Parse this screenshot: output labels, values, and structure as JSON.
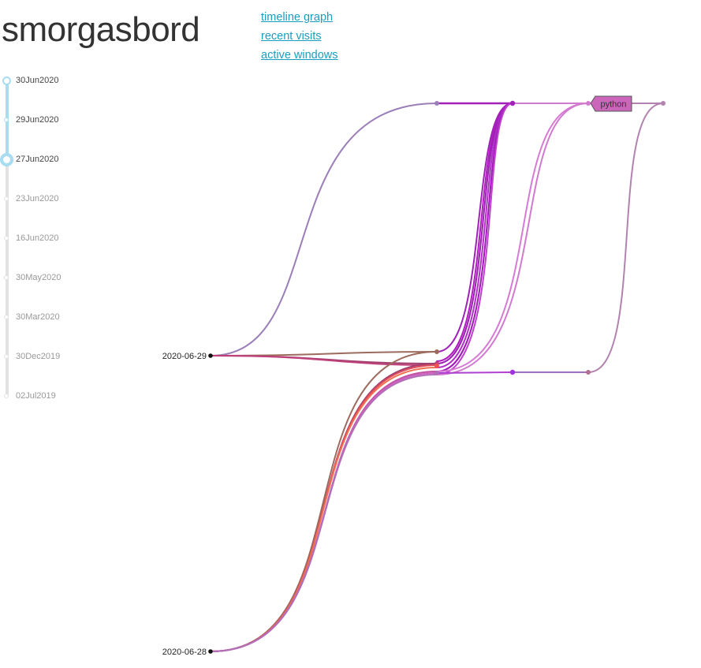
{
  "app": {
    "title": "smorgasbord"
  },
  "nav": {
    "links": [
      {
        "label": "timeline graph"
      },
      {
        "label": "recent visits"
      },
      {
        "label": "active windows"
      }
    ]
  },
  "timeline": {
    "dates": [
      {
        "label": "30Jun2020",
        "state": "selected"
      },
      {
        "label": "29Jun2020",
        "state": "in-range"
      },
      {
        "label": "27Jun2020",
        "state": "current"
      },
      {
        "label": "23Jun2020",
        "state": "inactive"
      },
      {
        "label": "16Jun2020",
        "state": "inactive"
      },
      {
        "label": "30May2020",
        "state": "inactive"
      },
      {
        "label": "30Mar2020",
        "state": "inactive"
      },
      {
        "label": "30Dec2019",
        "state": "inactive"
      },
      {
        "label": "02Jul2019",
        "state": "inactive"
      }
    ]
  },
  "graph": {
    "roots": [
      {
        "label": "2020-06-29"
      },
      {
        "label": "2020-06-28"
      }
    ],
    "tag": {
      "label": "python",
      "color": "#cc66bb"
    }
  },
  "colors": {
    "link": "#1b9dc0",
    "timeline_active": "#a8dcf0",
    "timeline_inactive": "#e2e2e2",
    "text_active": "#444444",
    "text_inactive": "#999999",
    "title": "#333333"
  }
}
